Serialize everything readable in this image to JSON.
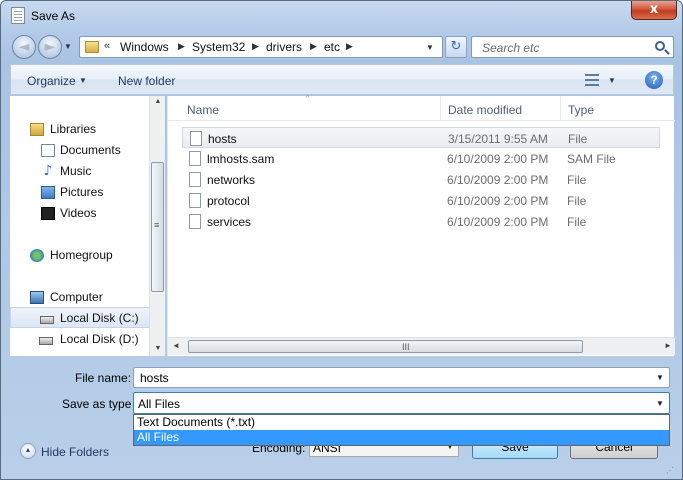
{
  "window": {
    "title": "Save As",
    "close_glyph": "x"
  },
  "nav": {
    "back_glyph": "◄",
    "forward_glyph": "►",
    "address_overflow": "«",
    "breadcrumbs": [
      "Windows",
      "System32",
      "drivers",
      "etc"
    ],
    "separator": "▶",
    "dropdown_glyph": "▼",
    "refresh_glyph": "↻",
    "search_placeholder": "Search etc"
  },
  "toolbar": {
    "organize": "Organize",
    "new_folder": "New folder",
    "caret": "▼",
    "help": "?"
  },
  "sidebar": {
    "items": [
      {
        "label": "Libraries",
        "icon": "libraries-icon"
      },
      {
        "label": "Documents",
        "icon": "documents-icon"
      },
      {
        "label": "Music",
        "icon": "music-icon",
        "glyph": "♪"
      },
      {
        "label": "Pictures",
        "icon": "pictures-icon"
      },
      {
        "label": "Videos",
        "icon": "videos-icon"
      },
      {
        "label": "Homegroup",
        "icon": "homegroup-icon"
      },
      {
        "label": "Computer",
        "icon": "computer-icon"
      },
      {
        "label": "Local Disk (C:)",
        "icon": "drive-icon",
        "selected": true
      },
      {
        "label": "Local Disk (D:)",
        "icon": "drive-icon"
      }
    ],
    "scroll_up": "▲",
    "scroll_down": "▼",
    "grip": "≡"
  },
  "files": {
    "columns": {
      "name": "Name",
      "date": "Date modified",
      "type": "Type"
    },
    "sort_glyph": "^",
    "rows": [
      {
        "name": "hosts",
        "date": "3/15/2011 9:55 AM",
        "type": "File",
        "selected": true
      },
      {
        "name": "lmhosts.sam",
        "date": "6/10/2009 2:00 PM",
        "type": "SAM File"
      },
      {
        "name": "networks",
        "date": "6/10/2009 2:00 PM",
        "type": "File"
      },
      {
        "name": "protocol",
        "date": "6/10/2009 2:00 PM",
        "type": "File"
      },
      {
        "name": "services",
        "date": "6/10/2009 2:00 PM",
        "type": "File"
      }
    ],
    "hscroll": {
      "left": "◄",
      "right": "►",
      "grip": "III"
    }
  },
  "form": {
    "file_name_label": "File name:",
    "file_name_value": "hosts",
    "save_type_label": "Save as type:",
    "save_type_value": "All Files",
    "type_options": [
      "Text Documents (*.txt)",
      "All Files"
    ],
    "selected_option": "All Files",
    "dropdown_glyph": "▼"
  },
  "bottom": {
    "hide_folders": "Hide Folders",
    "hide_glyph": "▲",
    "encoding_label": "Encoding:",
    "encoding_value": "ANSI",
    "save": "Save",
    "cancel": "Cancel",
    "grip": "⋰"
  },
  "colors": {
    "selection": "#3399ff",
    "link_text": "#1e395b",
    "frame": "#b3cbe8"
  }
}
